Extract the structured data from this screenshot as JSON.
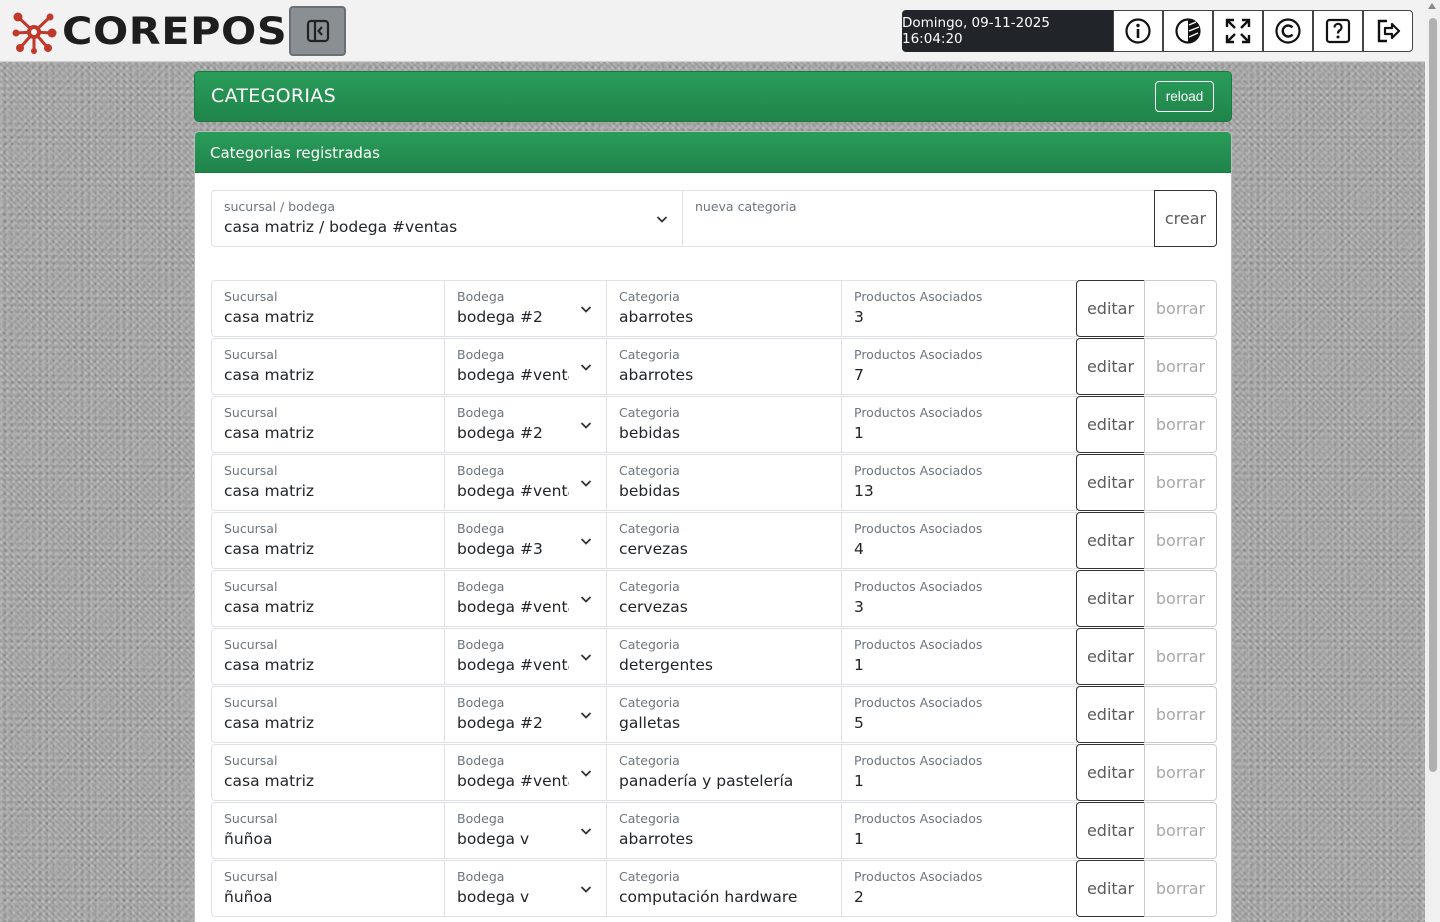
{
  "header": {
    "brand": "COREPOS",
    "datetime": "Domingo, 09-11-2025 16:04:20",
    "icons": [
      "info-icon",
      "contrast-icon",
      "fullscreen-icon",
      "copyright-icon",
      "help-icon",
      "logout-icon"
    ]
  },
  "page": {
    "title": "CATEGORIAS",
    "reload_label": "reload",
    "section_title": "Categorias registradas"
  },
  "create_form": {
    "sucursal_label": "sucursal / bodega",
    "sucursal_value": "casa matriz / bodega #ventas",
    "nueva_label": "nueva categoria",
    "nueva_value": "",
    "crear_label": "crear"
  },
  "labels": {
    "sucursal": "Sucursal",
    "bodega": "Bodega",
    "categoria": "Categoria",
    "productos": "Productos Asociados",
    "editar": "editar",
    "borrar": "borrar"
  },
  "rows": [
    {
      "sucursal": "casa matriz",
      "bodega": "bodega #2",
      "categoria": "abarrotes",
      "productos": "3"
    },
    {
      "sucursal": "casa matriz",
      "bodega": "bodega #ventas",
      "categoria": "abarrotes",
      "productos": "7"
    },
    {
      "sucursal": "casa matriz",
      "bodega": "bodega #2",
      "categoria": "bebidas",
      "productos": "1"
    },
    {
      "sucursal": "casa matriz",
      "bodega": "bodega #ventas",
      "categoria": "bebidas",
      "productos": "13"
    },
    {
      "sucursal": "casa matriz",
      "bodega": "bodega #3",
      "categoria": "cervezas",
      "productos": "4"
    },
    {
      "sucursal": "casa matriz",
      "bodega": "bodega #ventas",
      "categoria": "cervezas",
      "productos": "3"
    },
    {
      "sucursal": "casa matriz",
      "bodega": "bodega #ventas",
      "categoria": "detergentes",
      "productos": "1"
    },
    {
      "sucursal": "casa matriz",
      "bodega": "bodega #2",
      "categoria": "galletas",
      "productos": "5"
    },
    {
      "sucursal": "casa matriz",
      "bodega": "bodega #ventas",
      "categoria": "panadería y pastelería",
      "productos": "1"
    },
    {
      "sucursal": "ñuñoa",
      "bodega": "bodega v",
      "categoria": "abarrotes",
      "productos": "1"
    },
    {
      "sucursal": "ñuñoa",
      "bodega": "bodega v",
      "categoria": "computación hardware",
      "productos": "2"
    }
  ]
}
